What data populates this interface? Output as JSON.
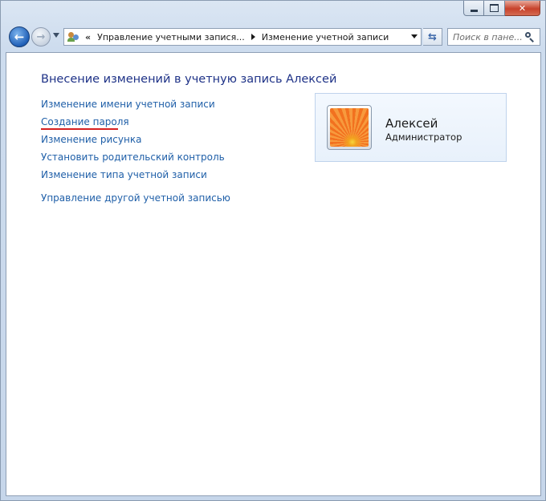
{
  "window": {
    "minimize_glyph": "min-glyph",
    "maximize_glyph": "max-glyph",
    "close_glyph": "✕"
  },
  "navigation": {
    "back_icon": "back-arrow-icon",
    "forward_icon": "forward-arrow-icon"
  },
  "address_bar": {
    "overflow_chevrons": "«",
    "segments": [
      "Управление учетными запися...",
      "Изменение учетной записи"
    ]
  },
  "search": {
    "placeholder": "Поиск в пане..."
  },
  "main": {
    "title": "Внесение изменений в учетную запись Алексей",
    "tasks": [
      "Изменение имени учетной записи",
      "Создание пароля",
      "Изменение рисунка",
      "Установить родительский контроль",
      "Изменение типа учетной записи"
    ],
    "other_task": "Управление другой учетной записью",
    "highlight_color": "#d62020",
    "link_color": "#1f5fa8"
  },
  "account": {
    "name": "Алексей",
    "role": "Администратор"
  }
}
